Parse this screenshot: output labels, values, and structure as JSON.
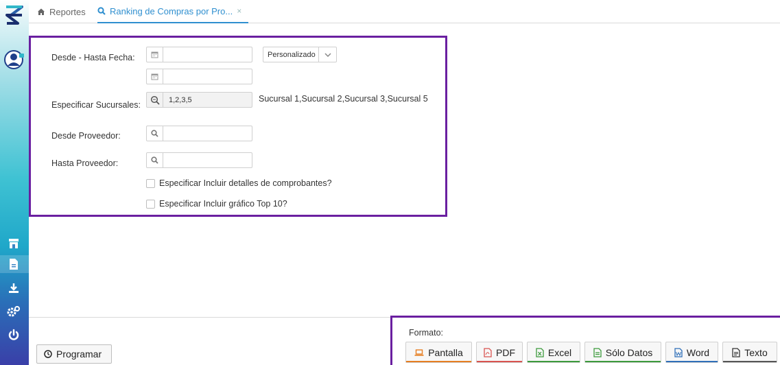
{
  "tabs": [
    {
      "label": "Reportes",
      "icon": "home-icon"
    },
    {
      "label": "Ranking de Compras por Pro...",
      "icon": "search-icon",
      "close": "×"
    }
  ],
  "form": {
    "fecha_label": "Desde - Hasta Fecha:",
    "fecha_desde": "",
    "fecha_hasta": "",
    "periodo": "Personalizado",
    "sucursales_label": "Especificar Sucursales:",
    "sucursales_value": "1,2,3,5",
    "sucursales_desc": "Sucursal 1,Sucursal 2,Sucursal 3,Sucursal 5",
    "desde_proveedor_label": "Desde Proveedor:",
    "hasta_proveedor_label": "Hasta Proveedor:",
    "chk_detalles": "Especificar Incluir detalles de comprobantes?",
    "chk_grafico": "Especificar Incluir gráfico Top 10?"
  },
  "footer": {
    "programar": "Programar",
    "formato_label": "Formato:",
    "buttons": [
      {
        "label": "Pantalla",
        "icon": "laptop-icon",
        "color": "#e67e22"
      },
      {
        "label": "PDF",
        "icon": "pdf-icon",
        "color": "#d9534f"
      },
      {
        "label": "Excel",
        "icon": "excel-icon",
        "color": "#3c9a3c"
      },
      {
        "label": "Sólo Datos",
        "icon": "data-file-icon",
        "color": "#3c9a3c"
      },
      {
        "label": "Word",
        "icon": "word-icon",
        "color": "#2f6fb8"
      },
      {
        "label": "Texto",
        "icon": "text-file-icon",
        "color": "#555555"
      }
    ]
  },
  "colors": {
    "accent": "#2f8fcf",
    "highlight_border": "#6a1fa0"
  }
}
